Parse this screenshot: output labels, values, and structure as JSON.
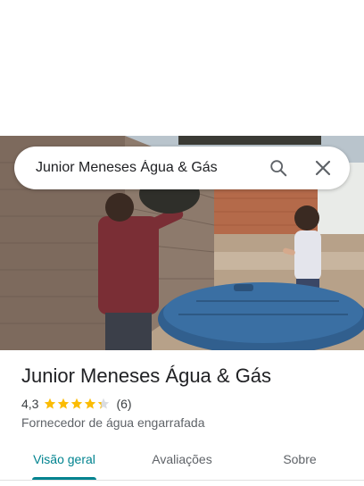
{
  "search": {
    "query": "Junior Meneses Água & Gás",
    "search_icon": "search-icon",
    "close_icon": "close-icon"
  },
  "hero": {
    "description_icon": "place-photo"
  },
  "place": {
    "name": "Junior Meneses Água & Gás",
    "rating": "4,3",
    "rating_value": 4.3,
    "rating_max": 5,
    "review_count": "(6)",
    "category": "Fornecedor de água engarrafada"
  },
  "tabs": [
    {
      "label": "Visão geral",
      "active": true
    },
    {
      "label": "Avaliações",
      "active": false
    },
    {
      "label": "Sobre",
      "active": false
    }
  ],
  "colors": {
    "accent": "#00838f",
    "star": "#fbbc04",
    "star_empty": "#dadce0"
  }
}
